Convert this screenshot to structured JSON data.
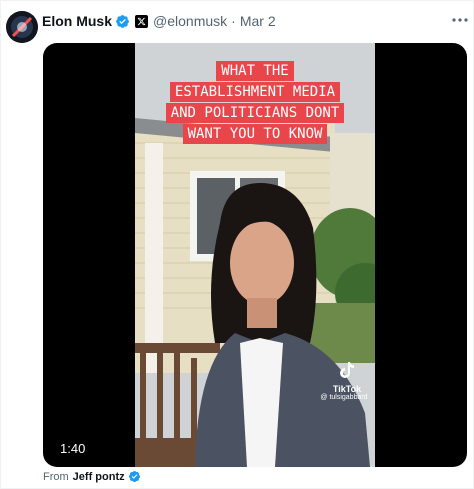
{
  "tweet": {
    "author_name": "Elon Musk",
    "handle": "@elonmusk",
    "separator": "·",
    "date": "Mar 2"
  },
  "video": {
    "caption_lines": [
      "WHAT THE",
      "ESTABLISHMENT MEDIA",
      "AND POLITICIANS DONT",
      "WANT YOU TO KNOW"
    ],
    "duration": "1:40",
    "tiktok_label": "TikTok",
    "tiktok_user": "@ tulsigabbard"
  },
  "attribution": {
    "prefix": "From",
    "source_name": "Jeff pontz"
  },
  "colors": {
    "verified": "#1d9bf0",
    "caption_bg": "#e8464a"
  },
  "icons": [
    "verified-badge-icon",
    "x-logo-icon",
    "more-options-icon",
    "tiktok-logo-icon"
  ]
}
